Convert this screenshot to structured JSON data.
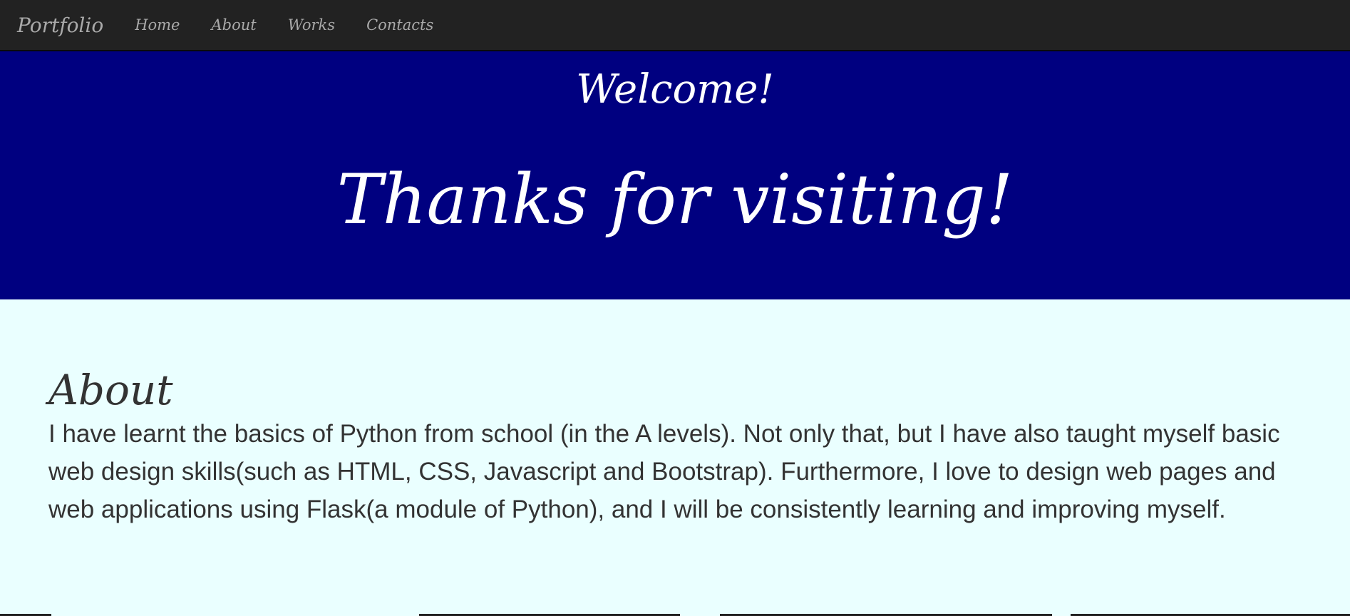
{
  "nav": {
    "brand": "Portfolio",
    "links": [
      "Home",
      "About",
      "Works",
      "Contacts"
    ]
  },
  "hero": {
    "welcome": "Welcome!",
    "thanks": "Thanks for visiting!"
  },
  "about": {
    "heading": "About",
    "text": "I have learnt the basics of Python from school (in the A levels). Not only that, but I have also taught myself basic web design skills(such as HTML, CSS, Javascript and Bootstrap). Furthermore, I love to design web pages and web applications using Flask(a module of Python), and I will be consistently learning and improving myself."
  },
  "colors": {
    "navbar": "#222222",
    "hero": "#000080",
    "page": "#eaffff",
    "nav_text": "#a9a9a9",
    "body_text": "#333333"
  }
}
